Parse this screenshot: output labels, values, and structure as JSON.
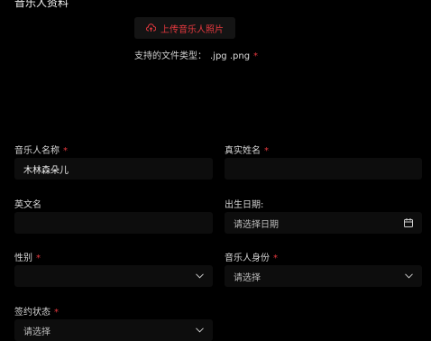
{
  "page": {
    "title": "音乐人资料"
  },
  "upload": {
    "button_label": "上传音乐人照片",
    "file_types_label": "支持的文件类型：",
    "file_types_value": ".jpg .png",
    "required_mark": "*"
  },
  "form": {
    "required_mark": "*",
    "artist_name": {
      "label": "音乐人名称",
      "value": "木林森朵儿",
      "required": true
    },
    "real_name": {
      "label": "真实姓名",
      "value": "",
      "required": true
    },
    "english_name": {
      "label": "英文名",
      "value": "",
      "required": false
    },
    "birth_date": {
      "label": "出生日期:",
      "placeholder": "请选择日期",
      "required": false
    },
    "gender": {
      "label": "性别",
      "value": "",
      "required": true
    },
    "artist_identity": {
      "label": "音乐人身份",
      "placeholder": "请选择",
      "required": true
    },
    "contract_status": {
      "label": "签约状态",
      "placeholder": "请选择",
      "required": true
    }
  },
  "icons": {
    "upload": "upload-cloud-icon",
    "calendar": "calendar-icon",
    "dropdown": "chevron-down-icon"
  },
  "colors": {
    "background": "#000000",
    "accent_red": "#e8393f",
    "field_background": "#0d0d0d"
  }
}
